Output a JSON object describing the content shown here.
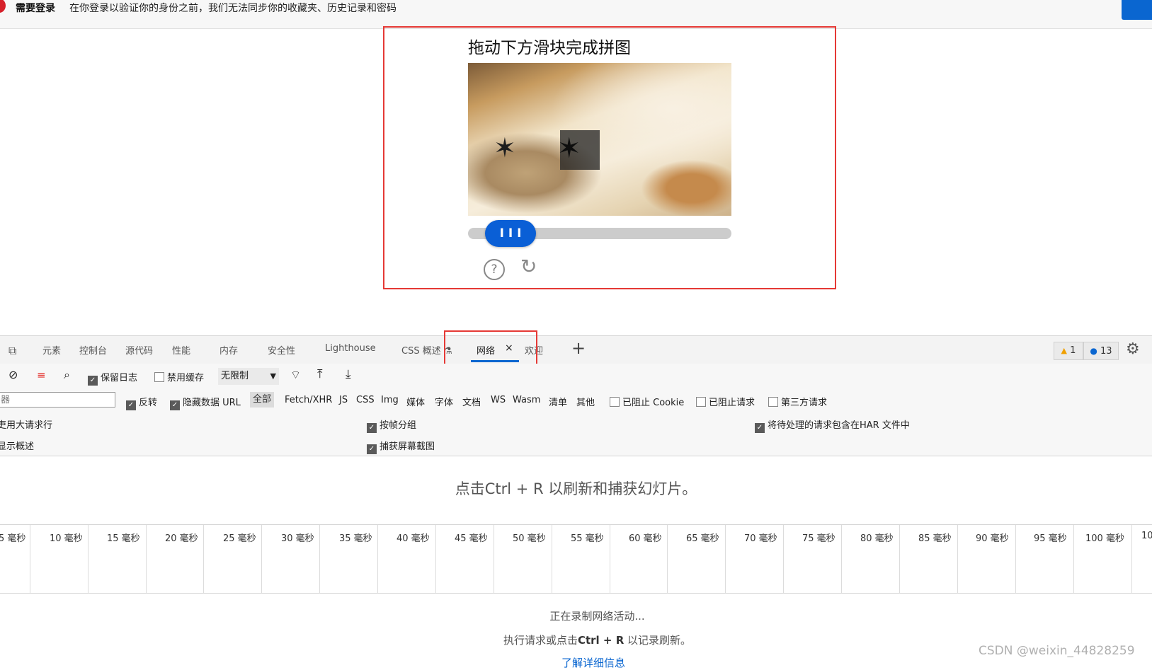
{
  "banner": {
    "title": "需要登录",
    "message": "在你登录以验证你的身份之前，我们无法同步你的收藏夹、历史记录和密码"
  },
  "captcha": {
    "title": "拖动下方滑块完成拼图",
    "slider_grip": "I I I",
    "help_glyph": "?",
    "refresh_glyph": "↻"
  },
  "devtools": {
    "tabs": [
      "元素",
      "控制台",
      "源代码",
      "性能",
      "内存",
      "安全性",
      "Lighthouse",
      "CSS 概述 ⚗",
      "网络",
      "欢迎"
    ],
    "active_tab": "网络",
    "tab_close": "×",
    "warnings_count": "1",
    "messages_count": "13",
    "toolbar": {
      "preserve_log": "保留日志",
      "disable_cache": "禁用缓存",
      "throttling": "无限制"
    },
    "filter": {
      "placeholder": "器",
      "invert": "反转",
      "hide_data_urls": "隐藏数据 URL",
      "types": [
        "全部",
        "Fetch/XHR",
        "JS",
        "CSS",
        "Img",
        "媒体",
        "字体",
        "文档",
        "WS",
        "Wasm",
        "清单",
        "其他"
      ],
      "blocked_cookies": "已阻止 Cookie",
      "blocked_requests": "已阻止请求",
      "third_party": "第三方请求"
    },
    "settings": {
      "big_rows": "吏用大请求行",
      "show_overview": "显示概述",
      "group_by_frame": "按帧分组",
      "capture_screenshots": "捕获屏幕截图",
      "har_pending": "将待处理的请求包含在HAR 文件中"
    },
    "hint": "点击Ctrl + R 以刷新和捕获幻灯片。",
    "timeline_ticks": [
      "5 毫秒",
      "10 毫秒",
      "15 毫秒",
      "20 毫秒",
      "25 毫秒",
      "30 毫秒",
      "35 毫秒",
      "40 毫秒",
      "45 毫秒",
      "50 毫秒",
      "55 毫秒",
      "60 毫秒",
      "65 毫秒",
      "70 毫秒",
      "75 毫秒",
      "80 毫秒",
      "85 毫秒",
      "90 毫秒",
      "95 毫秒",
      "100 毫秒",
      "10"
    ],
    "recording": "正在录制网络活动...",
    "perform_prefix": "执行请求或点击",
    "perform_key": "Ctrl + R",
    "perform_suffix": "以记录刷新。",
    "learn_more": "了解详细信息"
  },
  "watermark": "CSDN @weixin_44828259",
  "colors": {
    "accent": "#0a66d0",
    "highlight_red": "#e53935"
  }
}
